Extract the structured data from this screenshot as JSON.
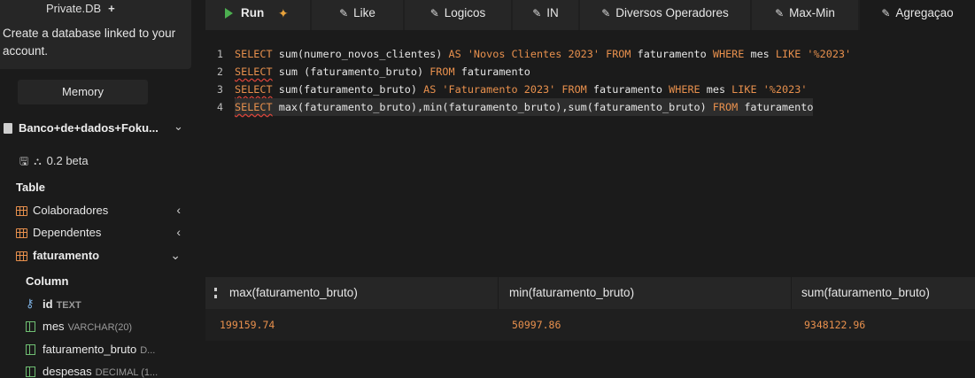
{
  "sidebar": {
    "promo_title": "Private.DB",
    "promo_plus": "+",
    "promo_text": "Create a database linked to your account.",
    "memory_label": "Memory",
    "database_name": "Banco+de+dados+Foku...",
    "version": "0.2 beta",
    "table_section": "Table",
    "tables": [
      {
        "name": "Colaboradores",
        "chevron": "‹"
      },
      {
        "name": "Dependentes",
        "chevron": "‹"
      },
      {
        "name": "faturamento",
        "chevron": "⌄"
      }
    ],
    "column_section": "Column",
    "columns": [
      {
        "name": "id",
        "type": "TEXT"
      },
      {
        "name": "mes",
        "type": "VARCHAR(20)"
      },
      {
        "name": "faturamento_bruto",
        "type": "D..."
      },
      {
        "name": "despesas",
        "type": "DECIMAL (1..."
      }
    ]
  },
  "toolbar": {
    "run_label": "Run",
    "tabs": [
      "Like",
      "Logicos",
      "IN",
      "Diversos Operadores",
      "Max-Min",
      "Agregaçao"
    ],
    "active_tab": "Agregaçao"
  },
  "editor": {
    "line_numbers": [
      "1",
      "2",
      "3",
      "4"
    ],
    "lines": [
      [
        {
          "t": "SELECT",
          "c": "kw"
        },
        {
          "t": " sum(numero_novos_clientes) ",
          "c": "fn"
        },
        {
          "t": "AS",
          "c": "kw"
        },
        {
          "t": " ",
          "c": "fn"
        },
        {
          "t": "'Novos Clientes 2023'",
          "c": "str"
        },
        {
          "t": " ",
          "c": "fn"
        },
        {
          "t": "FROM",
          "c": "kw"
        },
        {
          "t": " faturamento ",
          "c": "fn"
        },
        {
          "t": "WHERE",
          "c": "kw"
        },
        {
          "t": " mes ",
          "c": "fn"
        },
        {
          "t": "LIKE",
          "c": "kw"
        },
        {
          "t": " ",
          "c": "fn"
        },
        {
          "t": "'%2023'",
          "c": "str"
        }
      ],
      [
        {
          "t": "SELECT",
          "c": "kw squig"
        },
        {
          "t": " sum (faturamento_bruto) ",
          "c": "fn"
        },
        {
          "t": "FROM",
          "c": "kw"
        },
        {
          "t": " faturamento",
          "c": "fn"
        }
      ],
      [
        {
          "t": "SELECT",
          "c": "kw squig"
        },
        {
          "t": " sum(faturamento_bruto) ",
          "c": "fn"
        },
        {
          "t": "AS",
          "c": "kw"
        },
        {
          "t": " ",
          "c": "fn"
        },
        {
          "t": "'Faturamento 2023'",
          "c": "str"
        },
        {
          "t": " ",
          "c": "fn"
        },
        {
          "t": "FROM",
          "c": "kw"
        },
        {
          "t": " faturamento ",
          "c": "fn"
        },
        {
          "t": "WHERE",
          "c": "kw"
        },
        {
          "t": " mes ",
          "c": "fn"
        },
        {
          "t": "LIKE",
          "c": "kw"
        },
        {
          "t": " ",
          "c": "fn"
        },
        {
          "t": "'%2023'",
          "c": "str"
        }
      ],
      [
        {
          "t": "SELECT",
          "c": "kw squig"
        },
        {
          "t": " max(faturamento_bruto),min(faturamento_bruto),sum(faturamento_bruto) ",
          "c": "fn"
        },
        {
          "t": "FROM",
          "c": "kw"
        },
        {
          "t": " faturamento",
          "c": "fn"
        }
      ]
    ]
  },
  "results": {
    "columns": [
      "max(faturamento_bruto)",
      "min(faturamento_bruto)",
      "sum(faturamento_bruto)"
    ],
    "rows": [
      [
        "199159.74",
        "50997.86",
        "9348122.96"
      ]
    ]
  },
  "colors": {
    "keyword": "#e8904d",
    "run_icon": "#4caf50",
    "error_underline": "#e0453a",
    "table_icon": "#e8904d",
    "column_icon": "#6fbf73",
    "key_icon": "#7fb4e6"
  }
}
